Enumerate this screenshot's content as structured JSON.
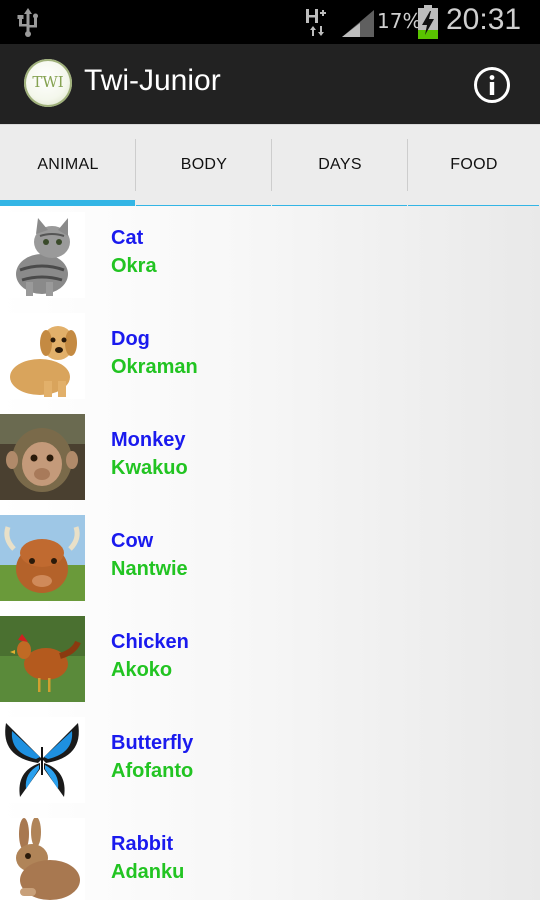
{
  "status_bar": {
    "usb_icon": "usb-icon",
    "network_icon": "hspa-network-icon",
    "signal_icon": "signal-icon",
    "battery_percent": "17%",
    "battery_icon": "battery-charging-icon",
    "time": "20:31"
  },
  "action_bar": {
    "logo_text": "TWI",
    "title": "Twi-Junior",
    "info_icon": "info-icon"
  },
  "tabs": [
    {
      "label": "ANIMAL",
      "selected": true
    },
    {
      "label": "BODY",
      "selected": false
    },
    {
      "label": "DAYS",
      "selected": false
    },
    {
      "label": "FOOD",
      "selected": false
    }
  ],
  "items": [
    {
      "english": "Cat",
      "twi": "Okra",
      "image": "cat-image"
    },
    {
      "english": "Dog",
      "twi": "Okraman",
      "image": "dog-image"
    },
    {
      "english": "Monkey",
      "twi": "Kwakuo",
      "image": "monkey-image"
    },
    {
      "english": "Cow",
      "twi": "Nantwie",
      "image": "cow-image"
    },
    {
      "english": "Chicken",
      "twi": "Akoko",
      "image": "chicken-image"
    },
    {
      "english": "Butterfly",
      "twi": "Afofanto",
      "image": "butterfly-image"
    },
    {
      "english": "Rabbit",
      "twi": "Adanku",
      "image": "rabbit-image"
    }
  ],
  "colors": {
    "english_text": "#1a1aee",
    "twi_text": "#22c422",
    "tab_indicator": "#33b5e5",
    "action_bar": "#222222"
  }
}
